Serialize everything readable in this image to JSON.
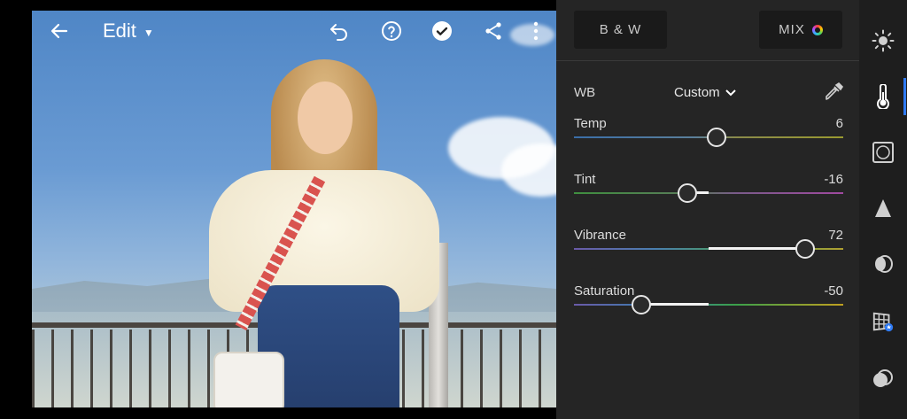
{
  "toolbar": {
    "back_icon": "arrow-left-icon",
    "edit_label": "Edit",
    "undo_icon": "undo-icon",
    "help_icon": "help-icon",
    "done_icon": "checkmark-icon",
    "share_icon": "share-icon",
    "more_icon": "more-vertical-icon"
  },
  "panel": {
    "bw_label": "B & W",
    "mix_label": "MIX",
    "wb": {
      "label": "WB",
      "value": "Custom"
    },
    "sliders": [
      {
        "label": "Temp",
        "value": "6",
        "level": 0.53
      },
      {
        "label": "Tint",
        "value": "-16",
        "level": 0.42
      },
      {
        "label": "Vibrance",
        "value": "72",
        "level": 0.86
      },
      {
        "label": "Saturation",
        "value": "-50",
        "level": 0.25
      }
    ]
  },
  "rail": {
    "items": [
      "light-icon",
      "color-icon",
      "effects-icon",
      "detail-icon",
      "optics-icon",
      "geometry-icon",
      "healing-icon"
    ],
    "active_index": 1,
    "accent": "#2f7bf5"
  }
}
